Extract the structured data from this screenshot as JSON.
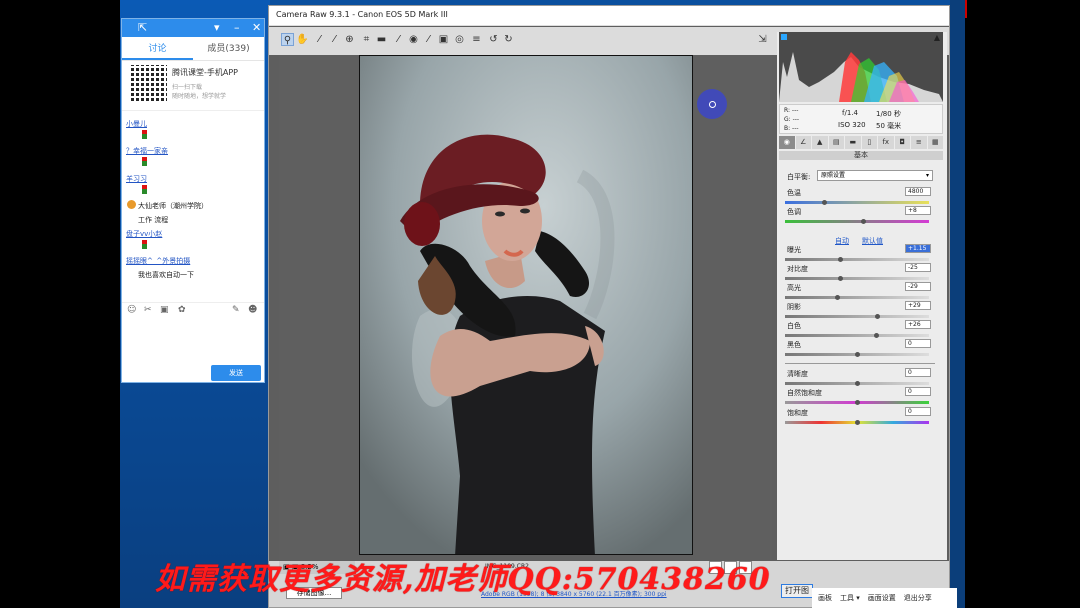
{
  "chat": {
    "tab_discuss": "讨论",
    "tab_members": "成员(339)",
    "app_title": "腾讯课堂-手机APP",
    "app_sub1": "扫一扫下载",
    "app_sub2": "随时随地，想学就学",
    "messages": [
      "小曼儿",
      "？幸福一家亲",
      "羊习习",
      "大仙老师（潮州学院）",
      "工作 流程",
      "盘子vv小赵",
      "摇摇眼^_^外景拍摄",
      "我也喜欢自动一下"
    ],
    "send_label": "发送"
  },
  "window": {
    "title": "Camera Raw 9.3.1 -  Canon EOS 5D Mark III"
  },
  "meta": {
    "r": "R:  ---",
    "g": "G:  ---",
    "b": "B:  ---",
    "aperture": "f/1.4",
    "shutter": "1/80 秒",
    "iso": "ISO 320",
    "focal": "50 毫米"
  },
  "panel": {
    "section": "基本",
    "wb_label": "白平衡:",
    "wb_value": "原照设置",
    "auto_label": "自动",
    "default_label": "默认值",
    "sliders": [
      {
        "label": "色温",
        "value": "4800",
        "pos": 0.27
      },
      {
        "label": "色调",
        "value": "+8",
        "pos": 0.54
      },
      {
        "label": "曝光",
        "value": "+1.15",
        "pos": 0.38
      },
      {
        "label": "对比度",
        "value": "-25",
        "pos": 0.38
      },
      {
        "label": "高光",
        "value": "-29",
        "pos": 0.36
      },
      {
        "label": "阴影",
        "value": "+29",
        "pos": 0.64
      },
      {
        "label": "白色",
        "value": "+26",
        "pos": 0.63
      },
      {
        "label": "黑色",
        "value": "0",
        "pos": 0.5
      },
      {
        "label": "清晰度",
        "value": "0",
        "pos": 0.5
      },
      {
        "label": "自然饱和度",
        "value": "0",
        "pos": 0.5
      },
      {
        "label": "饱和度",
        "value": "0",
        "pos": 0.5
      }
    ]
  },
  "bottom": {
    "save_label": "存储图像...",
    "info": "Adobe RGB (1998); 8 位; 3840 x 5760 (22.1 百万像素); 300 ppi",
    "open_label": "打开图",
    "zoom": "8.2%",
    "file": "IMG_1109.CR2"
  },
  "watermark": "如需获取更多资源,加老师QQ:570438260",
  "taskbar": [
    "画板",
    "工具 ▾",
    "画面设置",
    "退出分享"
  ],
  "colors": {
    "accent": "#2d8ceb",
    "watermark": "#ff1a1a"
  }
}
